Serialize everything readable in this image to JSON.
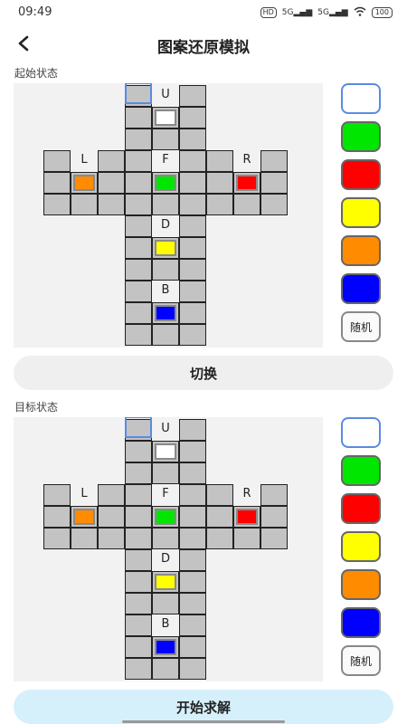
{
  "status": {
    "time": "09:49",
    "hd": "HD",
    "net1": "5G",
    "net2": "5G",
    "battery": "100"
  },
  "header": {
    "title": "图案还原模拟"
  },
  "start": {
    "label": "起始状态",
    "faces": {
      "U": "U",
      "L": "L",
      "F": "F",
      "R": "R",
      "D": "D",
      "B": "B"
    },
    "centers": {
      "U": "#ffffff",
      "L": "#ff8c00",
      "F": "#00e600",
      "R": "#ff0000",
      "D": "#ffff00",
      "B": "#0000ff"
    }
  },
  "target": {
    "label": "目标状态",
    "faces": {
      "U": "U",
      "L": "L",
      "F": "F",
      "R": "R",
      "D": "D",
      "B": "B"
    },
    "centers": {
      "U": "#ffffff",
      "L": "#ff8c00",
      "F": "#00e600",
      "R": "#ff0000",
      "D": "#ffff00",
      "B": "#0000ff"
    }
  },
  "palette": {
    "colors": [
      "#ffffff",
      "#00e600",
      "#ff0000",
      "#ffff00",
      "#ff8c00",
      "#0000ff"
    ],
    "color_names": [
      "white-swatch",
      "green-swatch",
      "red-swatch",
      "yellow-swatch",
      "orange-swatch",
      "blue-swatch"
    ],
    "random_label": "随机"
  },
  "buttons": {
    "switch_label": "切换",
    "solve_label": "开始求解"
  }
}
